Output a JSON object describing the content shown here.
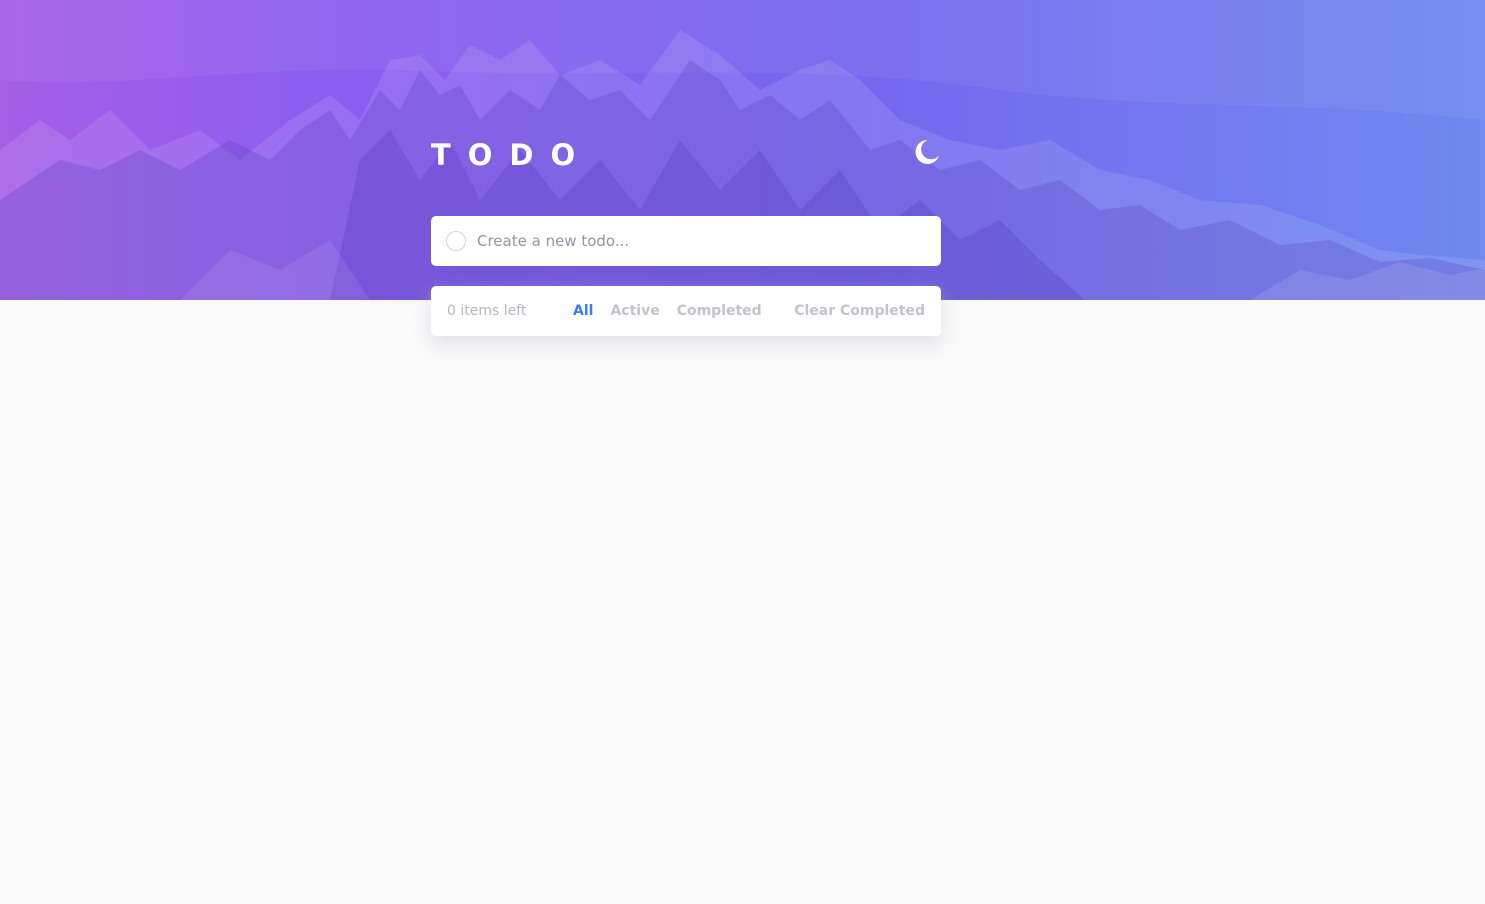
{
  "app": {
    "title": "TODO",
    "theme_icon": "moon-icon"
  },
  "new_todo": {
    "placeholder": "Create a new todo..."
  },
  "footer": {
    "items_left": "0 items left",
    "filters": [
      {
        "label": "All",
        "active": true
      },
      {
        "label": "Active",
        "active": false
      },
      {
        "label": "Completed",
        "active": false
      }
    ],
    "clear_label": "Clear Completed"
  },
  "colors": {
    "accent": "#3a7cfd",
    "gradient_start": "#a55ee6",
    "gradient_end": "#6f8af0",
    "page_background": "#fafafa"
  }
}
